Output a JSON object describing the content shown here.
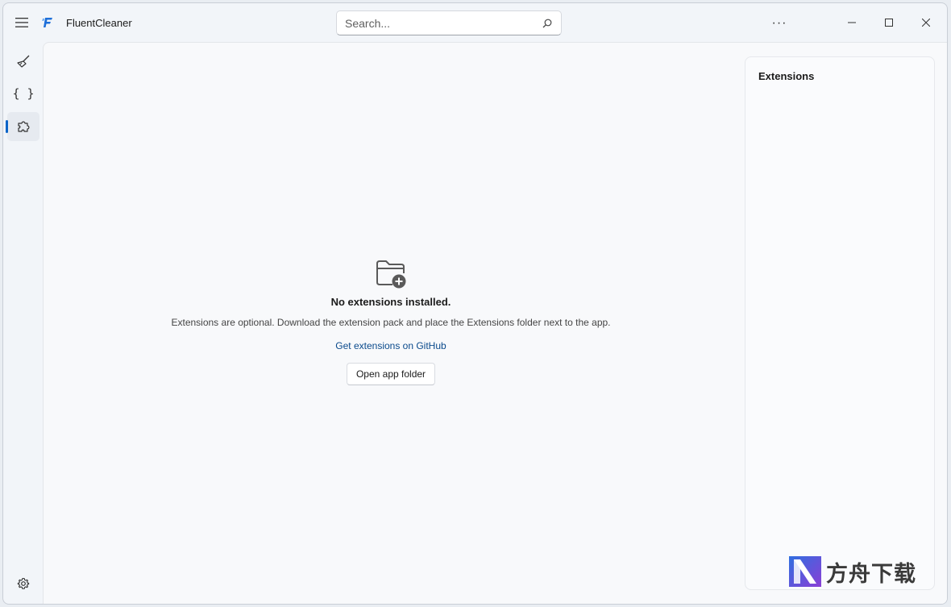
{
  "app": {
    "title": "FluentCleaner",
    "logo_color": "#1e6fd9"
  },
  "search": {
    "placeholder": "Search...",
    "value": ""
  },
  "titlebar": {
    "more_label": "···"
  },
  "nav": {
    "items": [
      {
        "icon": "broom-icon",
        "selected": false
      },
      {
        "icon": "braces-icon",
        "selected": false
      },
      {
        "icon": "puzzle-icon",
        "selected": true
      }
    ],
    "accent": "#0a64c8",
    "settings_icon": "gear-icon"
  },
  "empty_state": {
    "icon": "folder-add-icon",
    "title": "No extensions installed.",
    "description": "Extensions are optional. Download the extension pack and place the Extensions folder next to the app.",
    "link": "Get extensions on GitHub",
    "button": "Open app folder"
  },
  "side_panel": {
    "title": "Extensions"
  },
  "watermark": {
    "text": "方舟下载"
  }
}
